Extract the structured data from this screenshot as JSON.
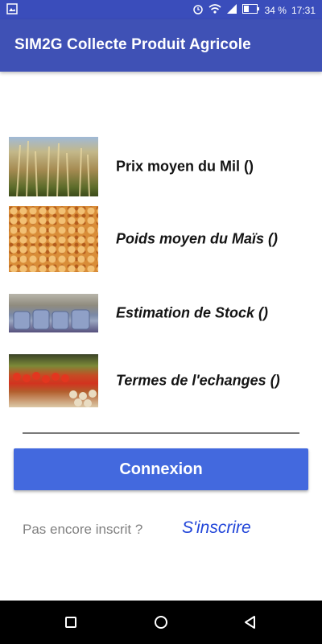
{
  "status_bar": {
    "battery_percent": "34 %",
    "time": "17:31",
    "icons": [
      "image-icon",
      "alarm-icon",
      "wifi-icon",
      "signal-icon",
      "battery-icon"
    ]
  },
  "app_bar": {
    "title": "SIM2G Collecte Produit Agricole",
    "color": "#3f51b5"
  },
  "menu": {
    "items": [
      {
        "label": "Prix moyen du Mil ()",
        "image": "millet-field-photo"
      },
      {
        "label": "Poids moyen du Maïs ()",
        "image": "corn-kernels-photo"
      },
      {
        "label": "Estimation de Stock ()",
        "image": "grain-sacks-photo"
      },
      {
        "label": "Termes de l'echanges ()",
        "image": "market-produce-photo"
      }
    ]
  },
  "login": {
    "button_label": "Connexion",
    "button_color": "#4369de"
  },
  "signup": {
    "prompt": "Pas encore inscrit ?",
    "link_label": "S'inscrire",
    "link_color": "#2145d9"
  },
  "nav_bar": {
    "buttons": [
      "recents-icon",
      "home-icon",
      "back-icon"
    ]
  }
}
